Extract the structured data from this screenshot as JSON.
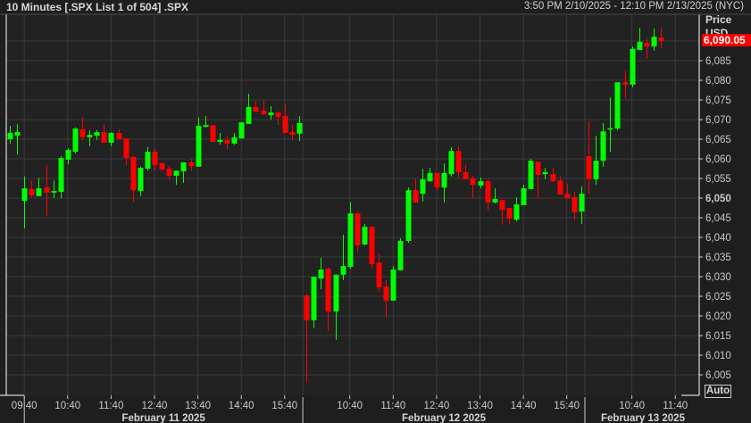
{
  "header": {
    "title": "10 Minutes [.SPX List 1 of 504] .SPX",
    "range": "3:50 PM 2/10/2025 - 12:10 PM 2/13/2025 (NYC)"
  },
  "price_axis": {
    "title_line1": "Price",
    "title_line2": "USD",
    "last_price": "6,090.05",
    "auto_label": "Auto"
  },
  "colors": {
    "up": "#00ff00",
    "down": "#ff0000",
    "background": "#222222",
    "grid": "#3a3a3a",
    "last_price_bg": "#ff0000"
  },
  "chart_data": {
    "type": "candlestick",
    "title": "10 Minutes [.SPX List 1 of 504] .SPX",
    "ylabel": "Price USD",
    "ylim": [
      6001,
      6097
    ],
    "yticks": [
      6005,
      6010,
      6015,
      6020,
      6025,
      6030,
      6035,
      6040,
      6045,
      6050,
      6055,
      6060,
      6065,
      6070,
      6075,
      6080,
      6085
    ],
    "ytick_labels": [
      "6,005",
      "6,010",
      "6,015",
      "6,020",
      "6,025",
      "6,030",
      "6,035",
      "6,040",
      "6,045",
      "6,050",
      "6,055",
      "6,060",
      "6,065",
      "6,070",
      "6,075",
      "6,080",
      "6,085"
    ],
    "grid": true,
    "xticks": [
      {
        "label": "09:40",
        "bar": 2
      },
      {
        "label": "10:40",
        "bar": 8
      },
      {
        "label": "11:40",
        "bar": 14
      },
      {
        "label": "12:40",
        "bar": 20
      },
      {
        "label": "13:40",
        "bar": 26
      },
      {
        "label": "14:40",
        "bar": 32
      },
      {
        "label": "15:40",
        "bar": 38
      },
      {
        "label": "10:40",
        "bar": 47
      },
      {
        "label": "11:40",
        "bar": 53
      },
      {
        "label": "12:40",
        "bar": 59
      },
      {
        "label": "13:40",
        "bar": 65
      },
      {
        "label": "14:40",
        "bar": 71
      },
      {
        "label": "15:40",
        "bar": 77
      },
      {
        "label": "10:40",
        "bar": 86
      },
      {
        "label": "11:40",
        "bar": 92
      }
    ],
    "sessions": [
      {
        "label": "February 11 2025",
        "start_bar": 2,
        "end_bar": 40
      },
      {
        "label": "February 12 2025",
        "start_bar": 41,
        "end_bar": 79
      },
      {
        "label": "February 13 2025",
        "start_bar": 80,
        "end_bar": 92
      }
    ],
    "ohlc": [
      [
        6065.0,
        6068.4,
        6063.9,
        6066.6
      ],
      [
        6065.9,
        6068.9,
        6061.1,
        6066.8
      ],
      [
        6049.3,
        6055.5,
        6042.3,
        6052.5
      ],
      [
        6052.3,
        6054.5,
        6050.2,
        6050.7
      ],
      [
        6050.5,
        6055.2,
        6050.5,
        6052.5
      ],
      [
        6052.7,
        6058.4,
        6045.5,
        6051.4
      ],
      [
        6051.4,
        6054.5,
        6050.0,
        6051.8
      ],
      [
        6051.6,
        6060.7,
        6050.0,
        6060.2
      ],
      [
        6059.8,
        6062.7,
        6058.6,
        6062.3
      ],
      [
        6061.8,
        6068.0,
        6061.4,
        6067.7
      ],
      [
        6067.5,
        6070.5,
        6064.8,
        6065.5
      ],
      [
        6065.5,
        6067.3,
        6063.2,
        6066.1
      ],
      [
        6065.9,
        6067.3,
        6064.8,
        6066.8
      ],
      [
        6066.8,
        6068.9,
        6064.1,
        6064.1
      ],
      [
        6064.1,
        6066.8,
        6063.2,
        6066.6
      ],
      [
        6066.6,
        6067.5,
        6064.8,
        6065.0
      ],
      [
        6065.2,
        6065.2,
        6058.4,
        6060.2
      ],
      [
        6060.5,
        6060.5,
        6049.1,
        6052.0
      ],
      [
        6051.8,
        6058.0,
        6050.5,
        6057.7
      ],
      [
        6057.5,
        6063.0,
        6057.0,
        6061.8
      ],
      [
        6061.8,
        6062.5,
        6057.0,
        6058.4
      ],
      [
        6058.9,
        6059.1,
        6056.8,
        6057.3
      ],
      [
        6057.5,
        6058.2,
        6054.5,
        6055.7
      ],
      [
        6055.7,
        6057.0,
        6053.4,
        6057.0
      ],
      [
        6056.8,
        6059.1,
        6053.9,
        6059.1
      ],
      [
        6059.1,
        6060.0,
        6057.0,
        6058.2
      ],
      [
        6058.0,
        6070.5,
        6058.0,
        6068.4
      ],
      [
        6068.2,
        6070.9,
        6068.0,
        6068.6
      ],
      [
        6068.6,
        6068.6,
        6064.3,
        6064.3
      ],
      [
        6064.3,
        6066.6,
        6063.6,
        6064.8
      ],
      [
        6064.8,
        6065.7,
        6062.5,
        6063.9
      ],
      [
        6063.9,
        6066.6,
        6063.6,
        6065.5
      ],
      [
        6065.2,
        6069.3,
        6065.2,
        6069.3
      ],
      [
        6068.9,
        6076.6,
        6068.9,
        6073.2
      ],
      [
        6073.2,
        6074.8,
        6072.0,
        6072.0
      ],
      [
        6072.3,
        6074.8,
        6071.1,
        6071.4
      ],
      [
        6071.1,
        6073.4,
        6070.0,
        6071.8
      ],
      [
        6071.8,
        6072.0,
        6068.6,
        6070.7
      ],
      [
        6070.9,
        6073.9,
        6066.6,
        6066.6
      ],
      [
        6066.8,
        6068.6,
        6064.8,
        6066.1
      ],
      [
        6066.4,
        6070.9,
        6064.5,
        6069.1
      ],
      [
        6025.2,
        6025.5,
        6003.0,
        6018.9
      ],
      [
        6018.9,
        6030.0,
        6017.0,
        6030.0
      ],
      [
        6029.5,
        6034.8,
        6026.8,
        6031.8
      ],
      [
        6032.0,
        6032.5,
        6016.1,
        6021.1
      ],
      [
        6021.1,
        6030.5,
        6013.9,
        6030.5
      ],
      [
        6030.5,
        6040.7,
        6029.1,
        6032.7
      ],
      [
        6032.5,
        6049.0,
        6032.0,
        6046.1
      ],
      [
        6046.1,
        6046.6,
        6036.1,
        6038.0
      ],
      [
        6038.2,
        6043.4,
        6038.0,
        6042.7
      ],
      [
        6042.7,
        6042.7,
        6032.0,
        6033.2
      ],
      [
        6033.6,
        6035.9,
        6026.1,
        6027.3
      ],
      [
        6027.5,
        6029.1,
        6019.5,
        6023.9
      ],
      [
        6023.9,
        6032.7,
        6023.9,
        6031.8
      ],
      [
        6031.6,
        6039.8,
        6031.6,
        6039.1
      ],
      [
        6039.1,
        6052.7,
        6038.6,
        6052.0
      ],
      [
        6052.0,
        6055.0,
        6048.9,
        6048.9
      ],
      [
        6051.1,
        6057.5,
        6049.1,
        6054.8
      ],
      [
        6054.3,
        6057.7,
        6054.1,
        6056.4
      ],
      [
        6056.4,
        6056.4,
        6052.0,
        6052.7
      ],
      [
        6052.7,
        6058.9,
        6048.9,
        6056.4
      ],
      [
        6056.1,
        6063.0,
        6055.5,
        6062.0
      ],
      [
        6062.0,
        6063.2,
        6055.2,
        6056.6
      ],
      [
        6056.6,
        6058.4,
        6054.8,
        6054.8
      ],
      [
        6055.0,
        6055.7,
        6050.0,
        6053.4
      ],
      [
        6053.2,
        6055.2,
        6052.5,
        6054.3
      ],
      [
        6054.3,
        6054.8,
        6047.0,
        6048.9
      ],
      [
        6048.9,
        6052.5,
        6048.6,
        6049.8
      ],
      [
        6049.5,
        6049.5,
        6043.2,
        6047.0
      ],
      [
        6047.5,
        6047.5,
        6043.4,
        6044.8
      ],
      [
        6044.5,
        6050.2,
        6044.1,
        6048.4
      ],
      [
        6048.2,
        6053.4,
        6048.2,
        6052.5
      ],
      [
        6052.3,
        6060.0,
        6052.3,
        6059.5
      ],
      [
        6059.3,
        6059.3,
        6050.0,
        6055.9
      ],
      [
        6056.1,
        6057.7,
        6054.8,
        6056.6
      ],
      [
        6056.1,
        6057.7,
        6054.1,
        6054.3
      ],
      [
        6054.5,
        6055.5,
        6050.9,
        6050.9
      ],
      [
        6051.1,
        6053.6,
        6049.8,
        6050.0
      ],
      [
        6050.2,
        6051.6,
        6044.5,
        6046.4
      ],
      [
        6046.6,
        6053.0,
        6043.4,
        6051.1
      ],
      [
        6060.7,
        6069.5,
        6050.9,
        6054.8
      ],
      [
        6054.8,
        6065.9,
        6053.4,
        6059.5
      ],
      [
        6059.5,
        6069.1,
        6058.0,
        6067.0
      ],
      [
        6067.7,
        6075.7,
        6061.8,
        6067.8
      ],
      [
        6067.7,
        6079.5,
        6067.3,
        6079.5
      ],
      [
        6079.5,
        6082.5,
        6075.5,
        6078.9
      ],
      [
        6078.9,
        6088.6,
        6078.2,
        6088.0
      ],
      [
        6087.7,
        6093.4,
        6087.7,
        6089.8
      ],
      [
        6089.5,
        6090.5,
        6085.5,
        6088.6
      ],
      [
        6088.6,
        6093.2,
        6087.5,
        6091.1
      ],
      [
        6090.9,
        6093.4,
        6088.2,
        6090.05
      ]
    ]
  }
}
